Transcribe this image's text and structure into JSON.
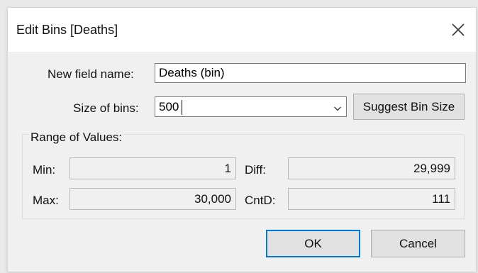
{
  "dialog": {
    "title": "Edit Bins [Deaths]",
    "close_icon": "close-icon"
  },
  "form": {
    "field_name_label": "New field name:",
    "field_name_value": "Deaths (bin)",
    "bin_size_label": "Size of bins:",
    "bin_size_value": "500",
    "suggest_label": "Suggest Bin Size"
  },
  "range": {
    "heading": "Range of Values:",
    "min_label": "Min:",
    "min_value": "1",
    "max_label": "Max:",
    "max_value": "30,000",
    "diff_label": "Diff:",
    "diff_value": "29,999",
    "cntd_label": "CntD:",
    "cntd_value": "111"
  },
  "buttons": {
    "ok": "OK",
    "cancel": "Cancel"
  },
  "colors": {
    "accent": "#0078d7",
    "dialog_bg": "#f0f0f0",
    "titlebar_bg": "#ffffff"
  }
}
